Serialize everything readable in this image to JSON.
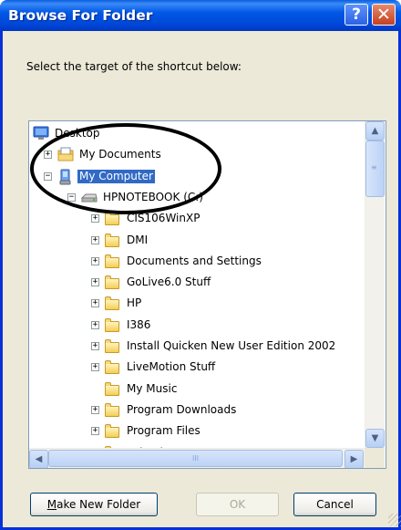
{
  "window": {
    "title": "Browse For Folder"
  },
  "title_buttons": {
    "help": "?",
    "close": "✕"
  },
  "instruction": "Select the target of the shortcut below:",
  "tree": {
    "items": [
      {
        "label": "Desktop",
        "icon": "desktop-icon",
        "expander": ""
      },
      {
        "label": "My Documents",
        "icon": "documents-folder-icon",
        "expander": "+"
      },
      {
        "label": "My Computer",
        "icon": "computer-icon",
        "expander": "−",
        "selected": true
      },
      {
        "label": "HPNOTEBOOK (C:)",
        "icon": "drive-icon",
        "expander": "−"
      },
      {
        "label": "CIS106WinXP",
        "icon": "folder-icon",
        "expander": "+"
      },
      {
        "label": "DMI",
        "icon": "folder-icon",
        "expander": "+"
      },
      {
        "label": "Documents and Settings",
        "icon": "folder-icon",
        "expander": "+"
      },
      {
        "label": "GoLive6.0 Stuff",
        "icon": "folder-icon",
        "expander": "+"
      },
      {
        "label": "HP",
        "icon": "folder-icon",
        "expander": "+"
      },
      {
        "label": "I386",
        "icon": "folder-icon",
        "expander": "+"
      },
      {
        "label": "Install Quicken New User Edition 2002",
        "icon": "folder-icon",
        "expander": "+"
      },
      {
        "label": "LiveMotion Stuff",
        "icon": "folder-icon",
        "expander": "+"
      },
      {
        "label": "My Music",
        "icon": "folder-icon",
        "expander": ""
      },
      {
        "label": "Program Downloads",
        "icon": "folder-icon",
        "expander": "+"
      },
      {
        "label": "Program Files",
        "icon": "folder-icon",
        "expander": "+"
      },
      {
        "label": "School",
        "icon": "folder-icon",
        "expander": "+"
      }
    ]
  },
  "scrollbars": {
    "up": "▲",
    "down": "▼",
    "left": "◀",
    "right": "▶",
    "grip": "≡",
    "hgrip": "III"
  },
  "buttons": {
    "make_new_folder": "Make New Folder",
    "ok": "OK",
    "cancel": "Cancel"
  },
  "colors": {
    "titlebar": "#0054E3",
    "selection": "#316AC5",
    "dialog_bg": "#ECE9D8"
  }
}
